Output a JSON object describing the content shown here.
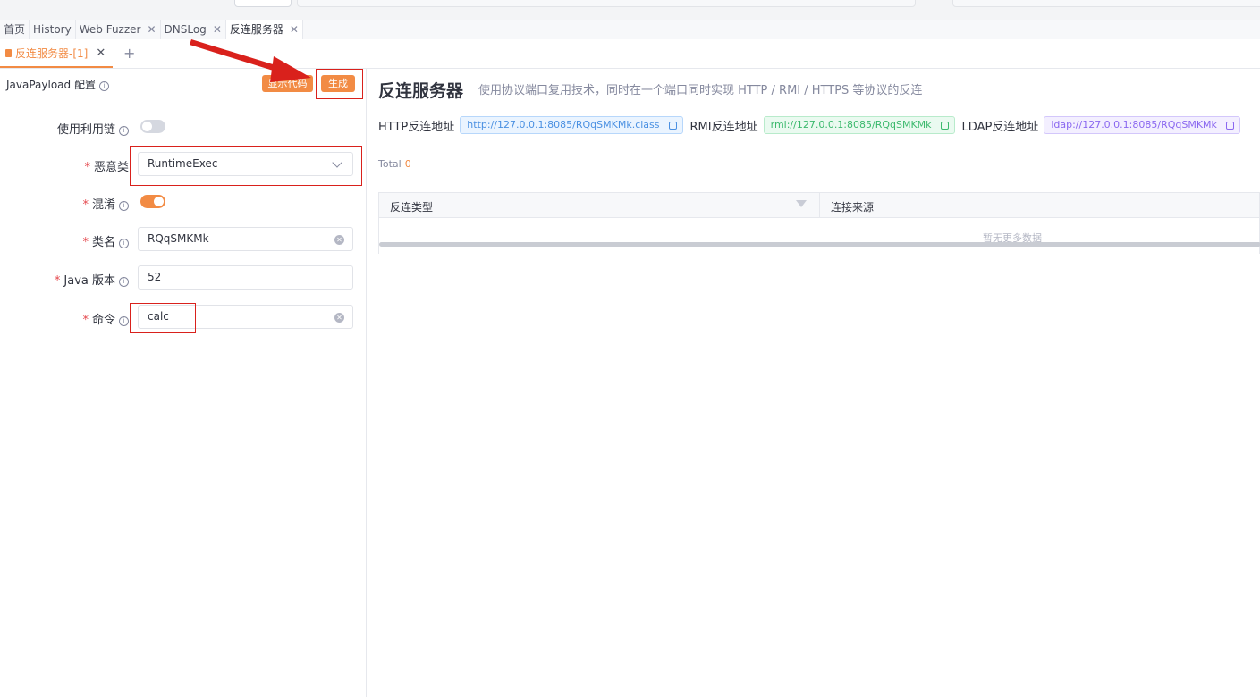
{
  "main_tabs": [
    {
      "label": "首页",
      "closable": false,
      "active": false
    },
    {
      "label": "History",
      "closable": false,
      "active": false
    },
    {
      "label": "Web Fuzzer",
      "closable": true,
      "active": false
    },
    {
      "label": "DNSLog",
      "closable": true,
      "active": false
    },
    {
      "label": "反连服务器",
      "closable": true,
      "active": true
    }
  ],
  "close_glyph": "✕",
  "sub_tab": {
    "label": "反连服务器-[1]",
    "close_glyph": "✕",
    "add_glyph": "+"
  },
  "left_panel": {
    "title": "JavaPayload 配置",
    "info_glyph": "i",
    "show_code_button": "显示代码",
    "generate_button": "生成",
    "fields": {
      "use_chain": {
        "label": "使用利用链",
        "enabled": false
      },
      "malicious_class": {
        "label": "恶意类",
        "required": true,
        "value": "RuntimeExec"
      },
      "obfuscate": {
        "label": "混淆",
        "required": true,
        "enabled": true
      },
      "class_name": {
        "label": "类名",
        "required": true,
        "value": "RQqSMKMk"
      },
      "java_version": {
        "label": "Java 版本",
        "required": true,
        "value": "52"
      },
      "command": {
        "label": "命令",
        "required": true,
        "value": "calc"
      }
    },
    "required_mark": "*",
    "clear_glyph": "✕"
  },
  "right_panel": {
    "title": "反连服务器",
    "description": "使用协议端口复用技术，同时在一个端口同时实现 HTTP / RMI / HTTPS 等协议的反连",
    "addresses": [
      {
        "label": "HTTP反连地址",
        "value": "http://127.0.0.1:8085/RQqSMKMk.class",
        "color": "#4a90e2"
      },
      {
        "label": "RMI反连地址",
        "value": "rmi://127.0.0.1:8085/RQqSMKMk",
        "color": "#3bb96d"
      },
      {
        "label": "LDAP反连地址",
        "value": "ldap://127.0.0.1:8085/RQqSMKMk",
        "color": "#8a67f0"
      }
    ],
    "total_label": "Total",
    "total_value": "0",
    "table": {
      "columns": [
        "反连类型",
        "连接来源"
      ],
      "empty_text": "暂无更多数据"
    }
  },
  "colors": {
    "accent": "#f28b44",
    "annotation_red": "#d9211c"
  }
}
